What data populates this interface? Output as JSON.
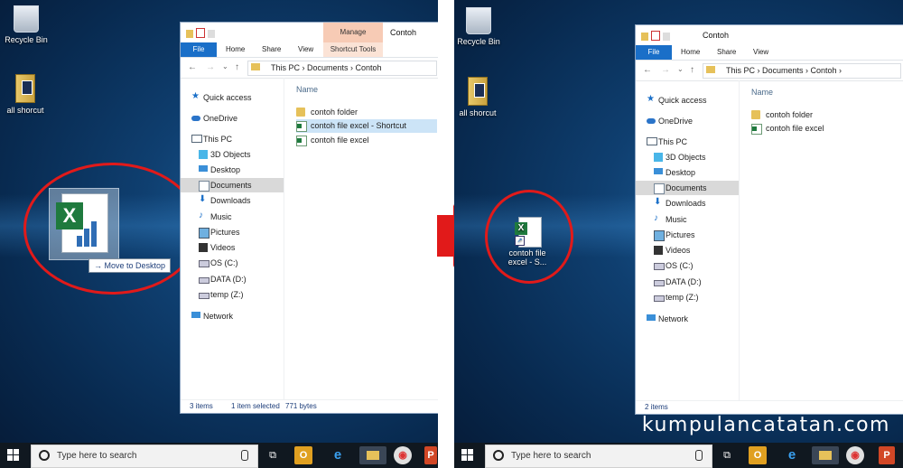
{
  "desktop": {
    "recycle_bin_label": "Recycle Bin",
    "all_shortcut_label": "all shorcut",
    "drag_tooltip": "Move to Desktop",
    "dropped_icon_label_line1": "contoh file",
    "dropped_icon_label_line2": "excel - S..."
  },
  "explorer_left": {
    "title": "Contoh",
    "manage_label": "Manage",
    "ribbon_tabs": [
      "File",
      "Home",
      "Share",
      "View"
    ],
    "shortcut_tools_label": "Shortcut Tools",
    "breadcrumb": "This PC  ›  Documents  ›  Contoh",
    "column_name": "Name",
    "nav": [
      "Quick access",
      "OneDrive",
      "This PC",
      "3D Objects",
      "Desktop",
      "Documents",
      "Downloads",
      "Music",
      "Pictures",
      "Videos",
      "OS (C:)",
      "DATA (D:)",
      "temp (Z:)",
      "Network"
    ],
    "files": [
      "contoh folder",
      "contoh file excel - Shortcut",
      "contoh file excel"
    ],
    "status_items": "3 items",
    "status_selected": "1 item selected",
    "status_size": "771 bytes"
  },
  "explorer_right": {
    "title": "Contoh",
    "ribbon_tabs": [
      "File",
      "Home",
      "Share",
      "View"
    ],
    "breadcrumb": "This PC  ›  Documents  ›  Contoh  ›",
    "column_name": "Name",
    "nav": [
      "Quick access",
      "OneDrive",
      "This PC",
      "3D Objects",
      "Desktop",
      "Documents",
      "Downloads",
      "Music",
      "Pictures",
      "Videos",
      "OS (C:)",
      "DATA (D:)",
      "temp (Z:)",
      "Network"
    ],
    "files": [
      "contoh folder",
      "contoh file excel"
    ],
    "status_items": "2 items"
  },
  "taskbar": {
    "search_placeholder": "Type here to search"
  },
  "watermark": "kumpulancatatan.com",
  "colors": {
    "accent": "#1a6fc8",
    "highlight_circle": "#e11a1a",
    "selection": "#cce4f7"
  }
}
